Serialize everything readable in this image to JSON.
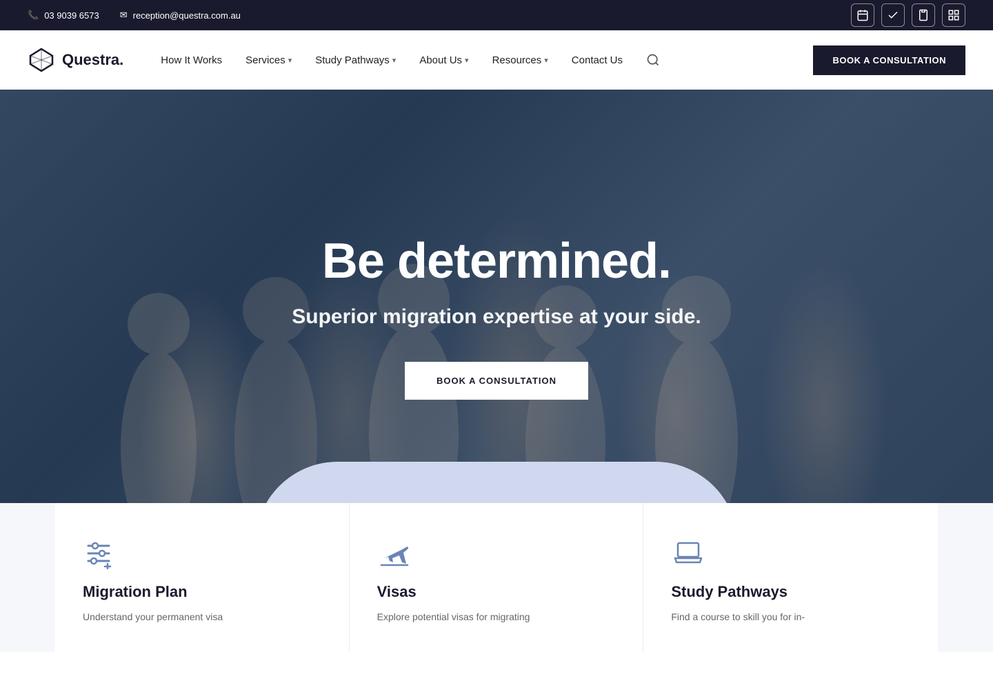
{
  "topbar": {
    "phone": "03 9039 6573",
    "email": "reception@questra.com.au",
    "icons": [
      "📅",
      "✅",
      "📋",
      "📊"
    ]
  },
  "navbar": {
    "logo_text": "Questra.",
    "book_btn": "BOOK A CONSULTATION",
    "nav_items": [
      {
        "label": "How It Works",
        "has_dropdown": false
      },
      {
        "label": "Services",
        "has_dropdown": true
      },
      {
        "label": "Study Pathways",
        "has_dropdown": true
      },
      {
        "label": "About Us",
        "has_dropdown": true
      },
      {
        "label": "Resources",
        "has_dropdown": true
      },
      {
        "label": "Contact Us",
        "has_dropdown": false
      }
    ]
  },
  "hero": {
    "title": "Be determined.",
    "subtitle": "Superior migration expertise at your side.",
    "cta_label": "BOOK A CONSULTATION"
  },
  "cards": [
    {
      "id": "migration-plan",
      "icon": "sliders",
      "title": "Migration Plan",
      "desc": "Understand your permanent visa"
    },
    {
      "id": "visas",
      "icon": "airplane",
      "title": "Visas",
      "desc": "Explore potential visas for migrating"
    },
    {
      "id": "study-pathways",
      "icon": "laptop",
      "title": "Study Pathways",
      "desc": "Find a course to skill you for in-"
    }
  ]
}
